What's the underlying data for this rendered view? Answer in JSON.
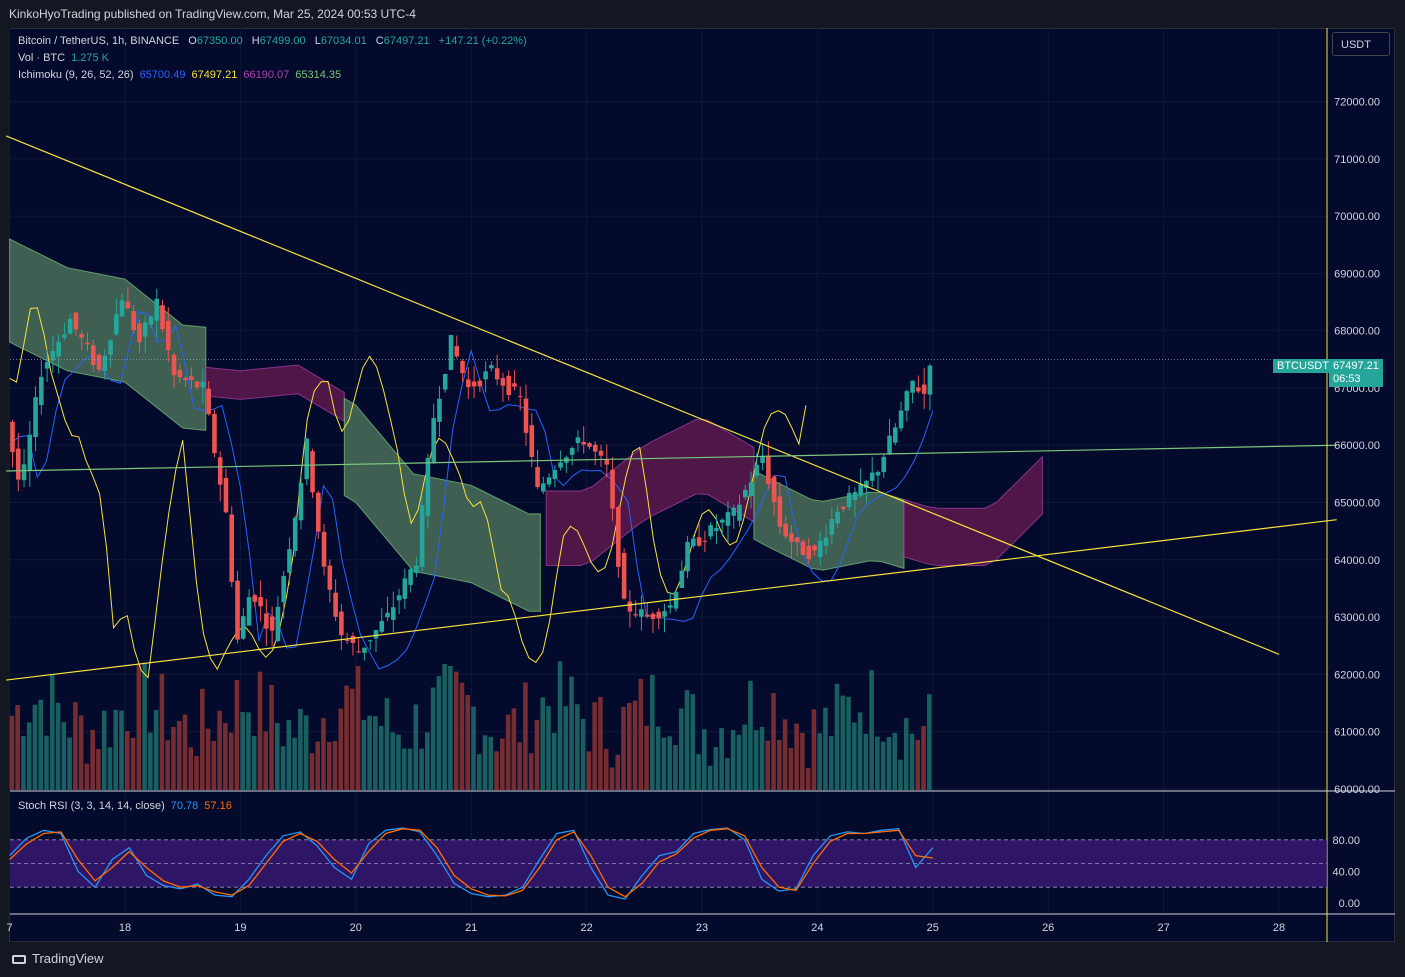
{
  "header": {
    "publish_line": "KinkoHyoTrading published on TradingView.com, Mar 25, 2024 00:53 UTC-4"
  },
  "legend": {
    "symbol": "Bitcoin / TetherUS, 1h, BINANCE",
    "o_label": "O",
    "o_value": "67350.00",
    "h_label": "H",
    "h_value": "67499.00",
    "l_label": "L",
    "l_value": "67034.01",
    "c_label": "C",
    "c_value": "67497.21",
    "change": "+147.21 (+0.22%)",
    "vol_label": "Vol · BTC",
    "vol_value": "1.275 K",
    "ichimoku_label": "Ichimoku (9, 26, 52, 26)",
    "ichimoku_values": [
      "65700.49",
      "67497.21",
      "66190.07",
      "65314.35"
    ],
    "stoch_label": "Stoch RSI (3, 3, 14, 14, close)",
    "stoch_k": "70.78",
    "stoch_d": "57.16"
  },
  "currency_button": "USDT",
  "price_tags": {
    "symbol": "BTCUSDT",
    "price": "67497.21",
    "countdown": "06:53"
  },
  "footer": {
    "brand": "TradingView"
  },
  "colors": {
    "background": "#030a2b",
    "up": "#26a69a",
    "down": "#ef5350",
    "trendline": "#f5e23c",
    "kijun": "#2962ff",
    "chikou": "#f5e23c",
    "cloud_bull": "#4a6e5a",
    "cloud_bear": "#5c1a4e",
    "stoch_k": "#2196f3",
    "stoch_d": "#ff6d00",
    "stoch_band": "#3d1a7a"
  },
  "chart_data": [
    {
      "type": "candlestick",
      "title": "Bitcoin / TetherUS, 1h, BINANCE",
      "x_ticks": [
        "7",
        "18",
        "19",
        "20",
        "21",
        "22",
        "23",
        "24",
        "25",
        "26",
        "27",
        "28"
      ],
      "y_ticks": [
        "60000.00",
        "61000.00",
        "62000.00",
        "63000.00",
        "64000.00",
        "65000.00",
        "66000.00",
        "67000.00",
        "68000.00",
        "69000.00",
        "70000.00",
        "71000.00",
        "72000.00"
      ],
      "ylim": [
        59980,
        73250
      ],
      "last_price": 67497.21,
      "price_path": [
        {
          "day": 17.0,
          "price": 66400
        },
        {
          "day": 17.12,
          "price": 65200
        },
        {
          "day": 17.3,
          "price": 67300
        },
        {
          "day": 17.55,
          "price": 68200
        },
        {
          "day": 17.8,
          "price": 67300
        },
        {
          "day": 18.0,
          "price": 68600
        },
        {
          "day": 18.15,
          "price": 67800
        },
        {
          "day": 18.3,
          "price": 68500
        },
        {
          "day": 18.45,
          "price": 67200
        },
        {
          "day": 18.7,
          "price": 67000
        },
        {
          "day": 18.9,
          "price": 64800
        },
        {
          "day": 19.0,
          "price": 62600
        },
        {
          "day": 19.12,
          "price": 63500
        },
        {
          "day": 19.3,
          "price": 62700
        },
        {
          "day": 19.5,
          "price": 64800
        },
        {
          "day": 19.6,
          "price": 66000
        },
        {
          "day": 19.75,
          "price": 63800
        },
        {
          "day": 19.9,
          "price": 62700
        },
        {
          "day": 20.05,
          "price": 62400
        },
        {
          "day": 20.3,
          "price": 63000
        },
        {
          "day": 20.55,
          "price": 64000
        },
        {
          "day": 20.7,
          "price": 66500
        },
        {
          "day": 20.85,
          "price": 67800
        },
        {
          "day": 21.0,
          "price": 67000
        },
        {
          "day": 21.2,
          "price": 67300
        },
        {
          "day": 21.45,
          "price": 66800
        },
        {
          "day": 21.6,
          "price": 65200
        },
        {
          "day": 21.8,
          "price": 65800
        },
        {
          "day": 22.0,
          "price": 66100
        },
        {
          "day": 22.2,
          "price": 65600
        },
        {
          "day": 22.35,
          "price": 63200
        },
        {
          "day": 22.55,
          "price": 63000
        },
        {
          "day": 22.75,
          "price": 63200
        },
        {
          "day": 22.9,
          "price": 64200
        },
        {
          "day": 23.1,
          "price": 64500
        },
        {
          "day": 23.3,
          "price": 64800
        },
        {
          "day": 23.55,
          "price": 65800
        },
        {
          "day": 23.7,
          "price": 64600
        },
        {
          "day": 23.85,
          "price": 64200
        },
        {
          "day": 24.0,
          "price": 64100
        },
        {
          "day": 24.2,
          "price": 64900
        },
        {
          "day": 24.4,
          "price": 65200
        },
        {
          "day": 24.55,
          "price": 65600
        },
        {
          "day": 24.7,
          "price": 66300
        },
        {
          "day": 24.85,
          "price": 67100
        },
        {
          "day": 24.95,
          "price": 66900
        },
        {
          "day": 25.0,
          "price": 67497
        }
      ],
      "volume_bars": 160,
      "trendlines": [
        {
          "name": "descending",
          "from": {
            "day": 16.97,
            "price": 71400
          },
          "to": {
            "day": 28.0,
            "price": 62350
          }
        },
        {
          "name": "ascending",
          "from": {
            "day": 16.97,
            "price": 61900
          },
          "to": {
            "day": 28.5,
            "price": 64700
          }
        },
        {
          "name": "horizontal-green",
          "from": {
            "day": 16.97,
            "price": 65550
          },
          "to": {
            "day": 28.5,
            "price": 66000
          }
        }
      ]
    },
    {
      "type": "line",
      "title": "Stoch RSI (3, 3, 14, 14, close)",
      "ylim": [
        0,
        100
      ],
      "y_ticks": [
        "0.00",
        "40.00",
        "80.00"
      ],
      "bands": [
        20,
        50,
        80
      ],
      "series": [
        {
          "name": "K",
          "values": [
            60,
            82,
            92,
            88,
            40,
            20,
            55,
            70,
            35,
            22,
            18,
            24,
            10,
            8,
            30,
            60,
            85,
            90,
            72,
            45,
            30,
            75,
            92,
            95,
            90,
            60,
            25,
            12,
            8,
            10,
            20,
            55,
            88,
            92,
            45,
            10,
            5,
            35,
            60,
            65,
            88,
            93,
            95,
            80,
            30,
            15,
            18,
            60,
            85,
            90,
            88,
            92,
            94,
            45,
            70
          ]
        },
        {
          "name": "D",
          "values": [
            55,
            75,
            88,
            90,
            55,
            28,
            45,
            65,
            45,
            28,
            20,
            22,
            14,
            10,
            22,
            50,
            78,
            88,
            78,
            55,
            38,
            65,
            88,
            94,
            92,
            70,
            35,
            18,
            10,
            9,
            16,
            45,
            80,
            90,
            60,
            20,
            8,
            25,
            52,
            62,
            82,
            92,
            94,
            85,
            45,
            20,
            16,
            50,
            78,
            88,
            88,
            90,
            92,
            60,
            57
          ]
        }
      ]
    }
  ]
}
